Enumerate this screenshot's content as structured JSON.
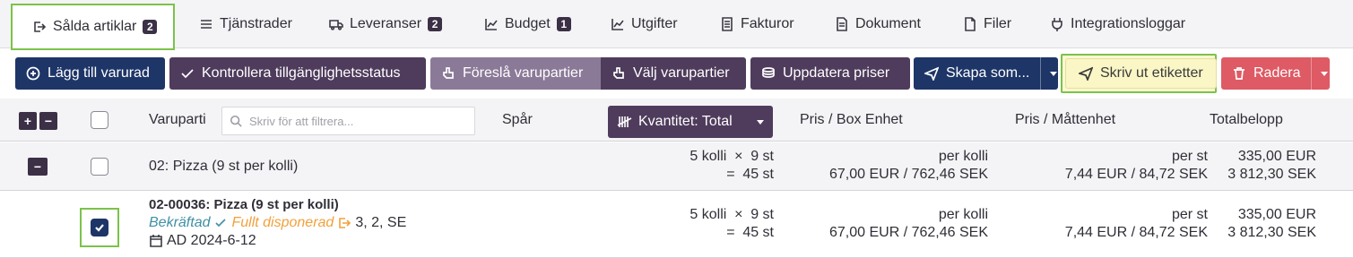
{
  "tabs": [
    {
      "label": "Sålda artiklar",
      "badge": "2",
      "icon": "export-icon",
      "active": true
    },
    {
      "label": "Tjänstrader",
      "icon": "list-icon"
    },
    {
      "label": "Leveranser",
      "badge": "2",
      "icon": "truck-icon"
    },
    {
      "label": "Budget",
      "badge": "1",
      "icon": "chart-line-icon"
    },
    {
      "label": "Utgifter",
      "icon": "chart-line-icon"
    },
    {
      "label": "Fakturor",
      "icon": "invoice-icon"
    },
    {
      "label": "Dokument",
      "icon": "document-icon"
    },
    {
      "label": "Filer",
      "icon": "file-icon"
    },
    {
      "label": "Integrationsloggar",
      "icon": "plug-icon"
    }
  ],
  "toolbar": {
    "add_item": "Lägg till varurad",
    "check_availability": "Kontrollera tillgänglighetsstatus",
    "suggest_batches": "Föreslå varupartier",
    "choose_batches": "Välj varupartier",
    "update_prices": "Uppdatera priser",
    "create_as": "Skapa som...",
    "print_labels": "Skriv ut etiketter",
    "delete": "Radera"
  },
  "table": {
    "headers": {
      "expand": "+",
      "collapse": "−",
      "batch": "Varuparti",
      "filter_placeholder": "Skriv för att filtrera...",
      "trace": "Spår",
      "quantity": "Kvantitet: Total",
      "price_box": "Pris / Box Enhet",
      "price_unit": "Pris / Måttenhet",
      "total": "Totalbelopp"
    },
    "group": {
      "toggle": "−",
      "name": "02: Pizza (9 st per kolli)",
      "qty_line1_left": "5 kolli",
      "qty_line1_op": "×",
      "qty_line1_right": "9 st",
      "qty_line2_op": "=",
      "qty_line2_right": "45 st",
      "box_price_label": "per kolli",
      "box_price": "67,00 EUR / 762,46 SEK",
      "unit_price_label": "per st",
      "unit_price": "7,44 EUR / 84,72 SEK",
      "total_eur": "335,00 EUR",
      "total_sek": "3 812,30 SEK"
    },
    "item": {
      "title": "02-00036: Pizza (9 st per kolli)",
      "status_confirmed": "Bekräftad",
      "status_disposed": "Fullt disponerad",
      "location": "3, 2, SE",
      "date": "AD 2024-6-12",
      "qty_line1_left": "5 kolli",
      "qty_line1_op": "×",
      "qty_line1_right": "9 st",
      "qty_line2_op": "=",
      "qty_line2_right": "45 st",
      "box_price_label": "per kolli",
      "box_price": "67,00 EUR / 762,46 SEK",
      "unit_price_label": "per st",
      "unit_price": "7,44 EUR / 84,72 SEK",
      "total_eur": "335,00 EUR",
      "total_sek": "3 812,30 SEK"
    }
  },
  "colors": {
    "navy": "#1e3567",
    "plum": "#4f3c5c",
    "mauve": "#8b7a97",
    "red": "#de5a64",
    "highlight": "#7cc24a",
    "confirmed": "#3f8fa5",
    "disposed": "#f0a13c"
  }
}
